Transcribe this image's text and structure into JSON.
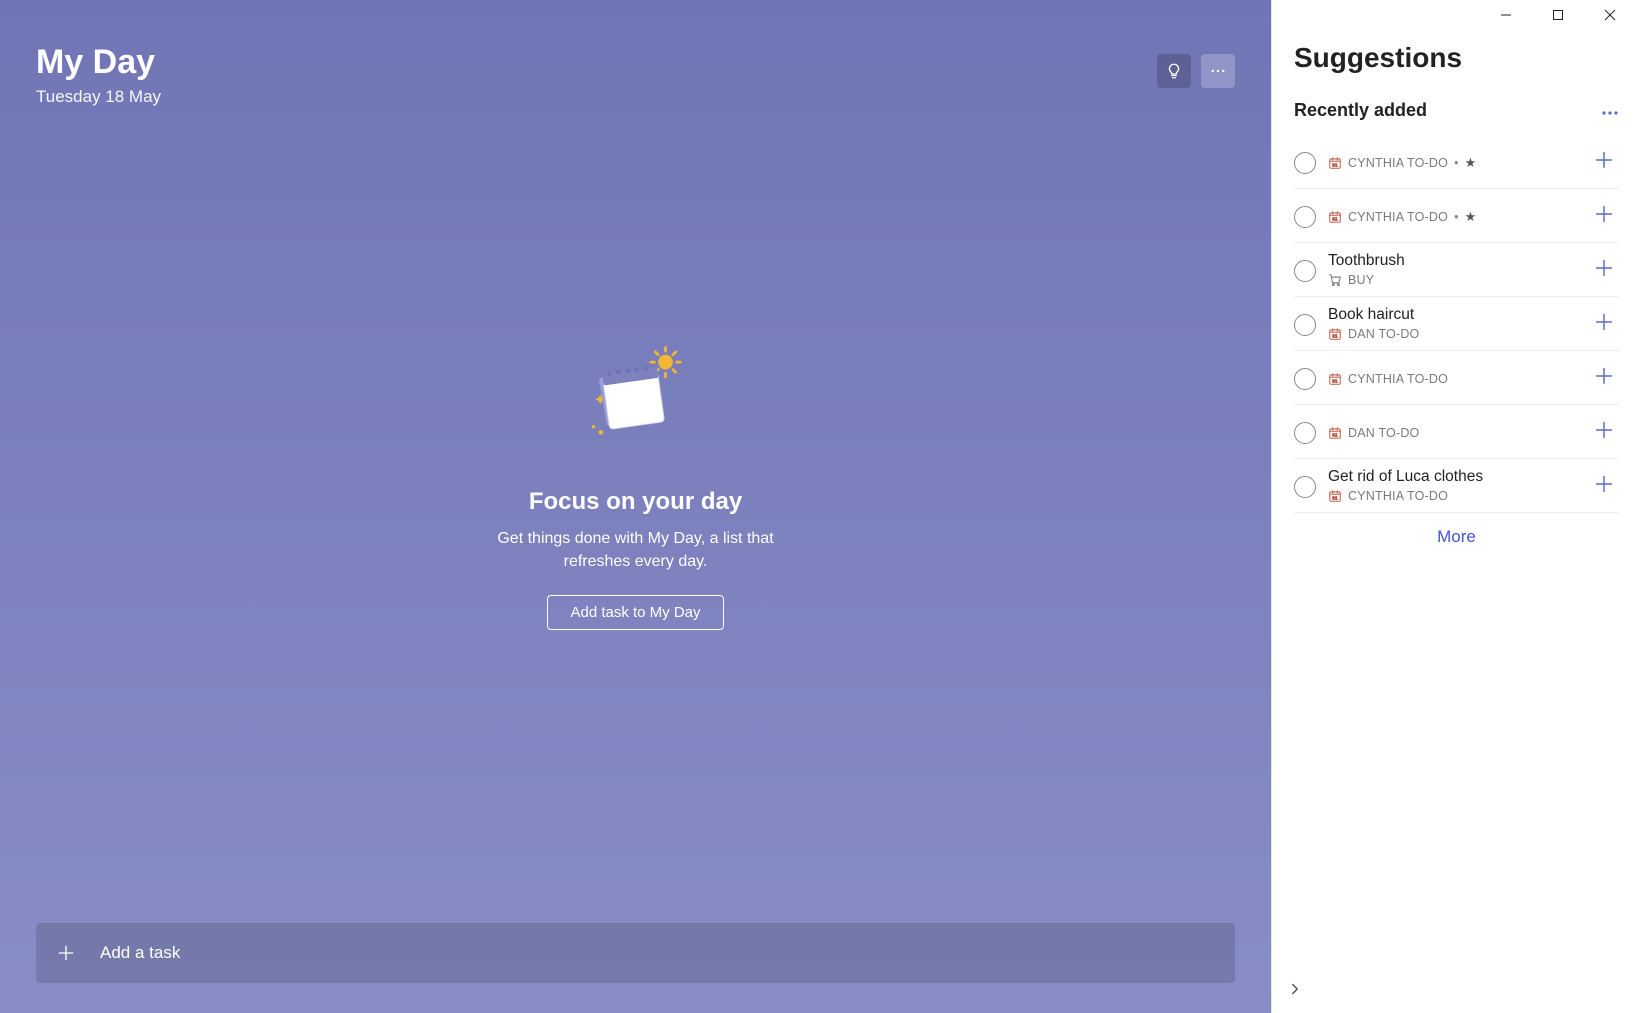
{
  "header": {
    "title": "My Day",
    "date": "Tuesday 18 May"
  },
  "empty": {
    "heading": "Focus on your day",
    "sub": "Get things done with My Day, a list that refreshes every day.",
    "cta": "Add task to My Day"
  },
  "addTask": {
    "placeholder": "Add a task"
  },
  "side": {
    "title": "Suggestions",
    "section": "Recently added",
    "more": "More",
    "items": [
      {
        "title": "",
        "list": "CYNTHIA TO-DO",
        "icon": "calendar",
        "starred": true
      },
      {
        "title": "",
        "list": "CYNTHIA TO-DO",
        "icon": "calendar",
        "starred": true
      },
      {
        "title": "Toothbrush",
        "list": "BUY",
        "icon": "cart",
        "starred": false
      },
      {
        "title": "Book haircut",
        "list": "DAN TO-DO",
        "icon": "calendar",
        "starred": false
      },
      {
        "title": "",
        "list": "CYNTHIA TO-DO",
        "icon": "calendar",
        "starred": false
      },
      {
        "title": "",
        "list": "DAN TO-DO",
        "icon": "calendar",
        "starred": false
      },
      {
        "title": "Get rid of Luca clothes",
        "list": "CYNTHIA TO-DO",
        "icon": "calendar",
        "starred": false
      }
    ]
  },
  "colors": {
    "accent": "#5c6ac4",
    "mainBg": "#7d82bf"
  }
}
